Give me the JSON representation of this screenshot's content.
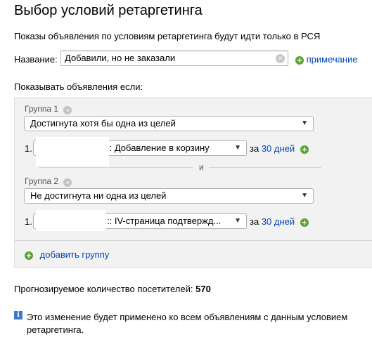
{
  "page": {
    "title": "Выбор условий ретаргетинга",
    "intro": "Показы объявления по условиям ретаргетинга будут идти только в РСЯ",
    "name_label": "Название:",
    "name_value": "Добавили, но не заказали",
    "note_link": "примечание",
    "show_if": "Показывать объявления если:"
  },
  "groups": [
    {
      "label": "Группа 1",
      "condition": "Достигнута хотя бы одна из целей",
      "row_num": "1.",
      "goal_select": ":: Добавление в корзину",
      "za": "за",
      "days": "30 дней"
    },
    {
      "label": "Группа 2",
      "condition": "Не достигнута ни одна из целей",
      "row_num": "1.",
      "goal_select": ":: IV-страница подтвержд...",
      "za": "за",
      "days": "30 дней"
    }
  ],
  "separator": "и",
  "add_group": "добавить группу",
  "forecast": {
    "label": "Прогнозируемое количество посетителей:",
    "value": "570"
  },
  "info": {
    "icon": "i",
    "text": "Это изменение будет применено ко всем объявлениям с данным условием ретаргетинга."
  },
  "icons": {
    "plus": "+",
    "clear": "×",
    "dropdown": "▼"
  }
}
